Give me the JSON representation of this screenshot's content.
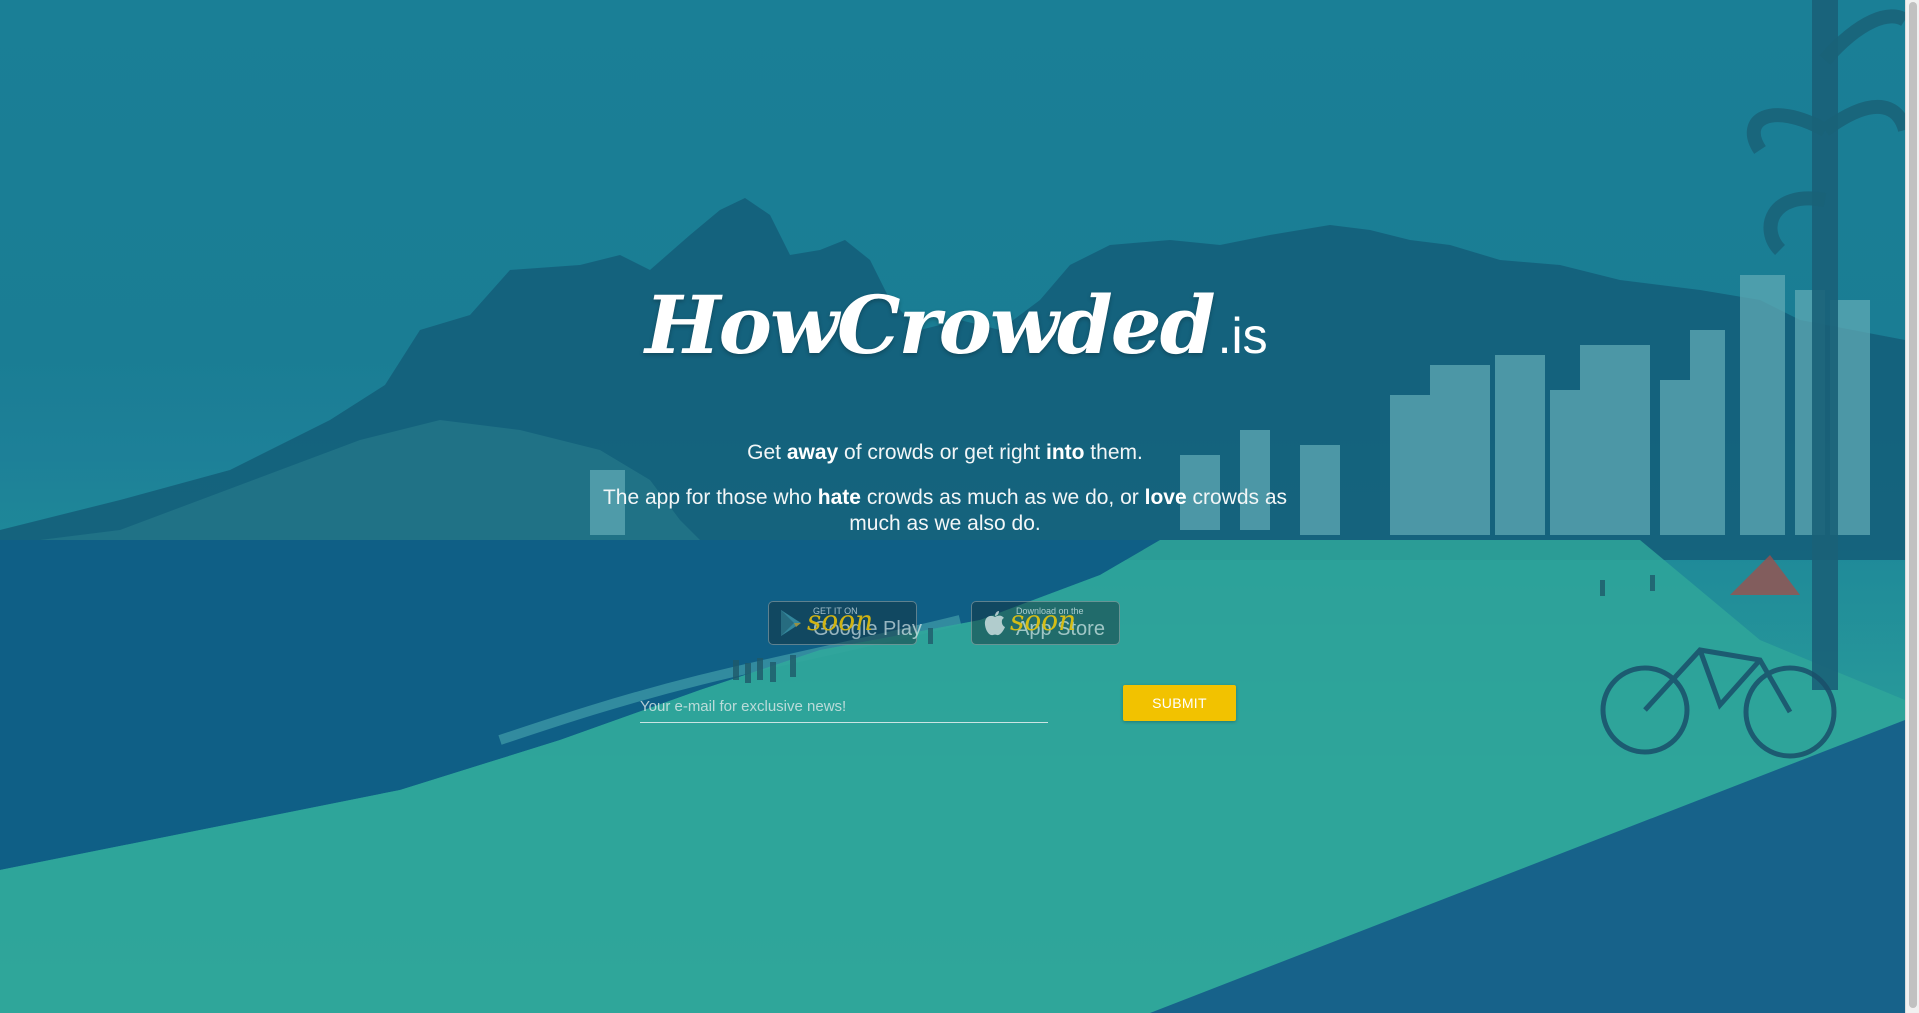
{
  "logo": {
    "script": "HowCrowded",
    "suffix": ".is"
  },
  "tagline": {
    "p1": "Get ",
    "b1": "away",
    "p2": " of crowds or get right ",
    "b2": "into",
    "p3": " them."
  },
  "description": {
    "p1": "The app for those who ",
    "b1": "hate",
    "p2": " crowds as much as we do, or ",
    "b2": "love",
    "p3": " crowds as much as we also do."
  },
  "stores": {
    "google": {
      "small": "GET IT ON",
      "big": "Google Play",
      "overlay": "soon"
    },
    "apple": {
      "small": "Download on the",
      "big": "App Store",
      "overlay": "soon"
    }
  },
  "signup": {
    "email_placeholder": "Your e-mail for exclusive news!",
    "submit_label": "SUBMIT"
  },
  "colors": {
    "overlay": "#1a7f96",
    "accent": "#f2c200"
  }
}
